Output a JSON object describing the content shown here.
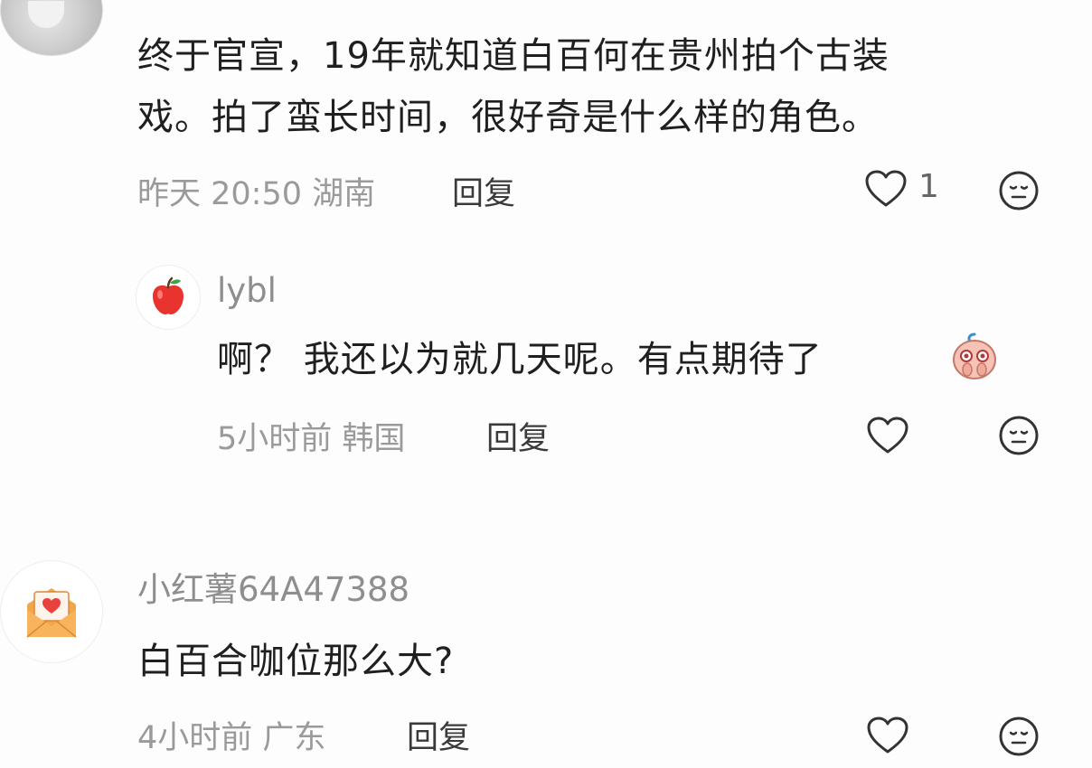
{
  "comments": [
    {
      "text_line1": "终于官宣，19年就知道白百何在贵州拍个古装",
      "text_line2": "戏。拍了蛮长时间，很好奇是什么样的角色。",
      "meta": "昨天 20:50 湖南",
      "reply_label": "回复",
      "like_count": "1"
    },
    {
      "username": "lybl",
      "text": "啊？ 我还以为就几天呢。有点期待了",
      "meta": "5小时前 韩国",
      "reply_label": "回复"
    },
    {
      "username": "小红薯64A47388",
      "text": "白百合咖位那么大?",
      "meta": "4小时前 广东",
      "reply_label": "回复"
    }
  ],
  "icons": {
    "like": "heart-outline-icon",
    "dislike": "neutral-face-icon",
    "reply_avatar": "apple-avatar-icon",
    "user_avatar": "envelope-heart-avatar-icon",
    "emoji": "shy-emoji-sticker"
  },
  "colors": {
    "text": "#1f1f1f",
    "meta": "#9a9a9a",
    "icon": "#333333",
    "apple": "#e8332e",
    "envelope": "#f2a64a"
  }
}
